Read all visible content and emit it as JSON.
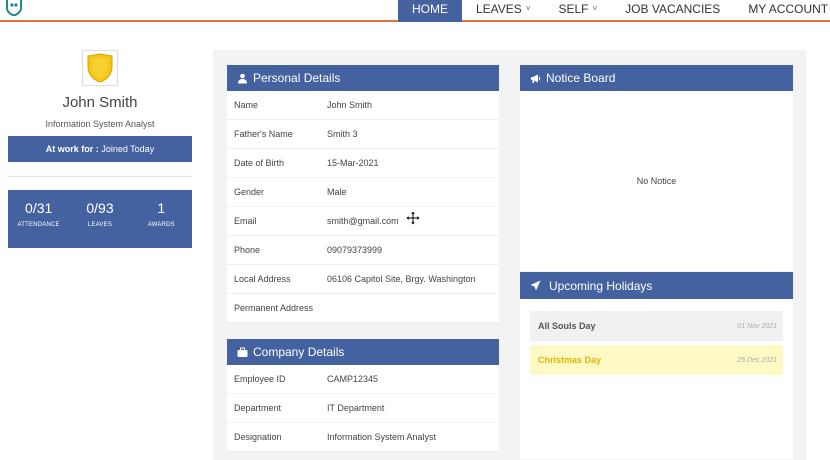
{
  "nav": {
    "items": [
      {
        "label": "HOME",
        "active": true,
        "dropdown": false
      },
      {
        "label": "LEAVES",
        "active": false,
        "dropdown": true
      },
      {
        "label": "SELF",
        "active": false,
        "dropdown": true
      },
      {
        "label": "JOB VACANCIES",
        "active": false,
        "dropdown": false
      },
      {
        "label": "MY ACCOUNT",
        "active": false,
        "dropdown": true
      }
    ],
    "caret": "˅"
  },
  "profile": {
    "name": "John Smith",
    "role": "Information System Analyst",
    "at_work_label": "At work for :",
    "at_work_value": "Joined Today",
    "stats": [
      {
        "value": "0/31",
        "label": "ATTENDANCE"
      },
      {
        "value": "0/93",
        "label": "LEAVES"
      },
      {
        "value": "1",
        "label": "AWARDS"
      }
    ]
  },
  "personal": {
    "title": "Personal Details",
    "rows": [
      {
        "label": "Name",
        "value": "John Smith"
      },
      {
        "label": "Father's Name",
        "value": "Smith 3"
      },
      {
        "label": "Date of Birth",
        "value": "15-Mar-2021"
      },
      {
        "label": "Gender",
        "value": "Male"
      },
      {
        "label": "Email",
        "value": "smith@gmail.com"
      },
      {
        "label": "Phone",
        "value": "09079373999"
      },
      {
        "label": "Local Address",
        "value": "06106 Capitol Site, Brgy. Washington"
      },
      {
        "label": "Permanent Address",
        "value": ""
      }
    ]
  },
  "company": {
    "title": "Company Details",
    "rows": [
      {
        "label": "Employee ID",
        "value": "CAMP12345"
      },
      {
        "label": "Department",
        "value": "IT Department"
      },
      {
        "label": "Designation",
        "value": "Information System Analyst"
      }
    ]
  },
  "notice": {
    "title": "Notice Board",
    "empty_text": "No Notice"
  },
  "holidays": {
    "title": "Upcoming Holidays",
    "items": [
      {
        "name": "All Souls Day",
        "date": "01 Nov 2021"
      },
      {
        "name": "Christmas Day",
        "date": "25 Dec 2021"
      }
    ]
  },
  "colors": {
    "primary": "#4462a0",
    "accent_line": "#e0733a",
    "highlight_holiday_bg": "#fff9c6",
    "highlight_holiday_text": "#e0b400",
    "badge_gold": "#f5c518"
  }
}
